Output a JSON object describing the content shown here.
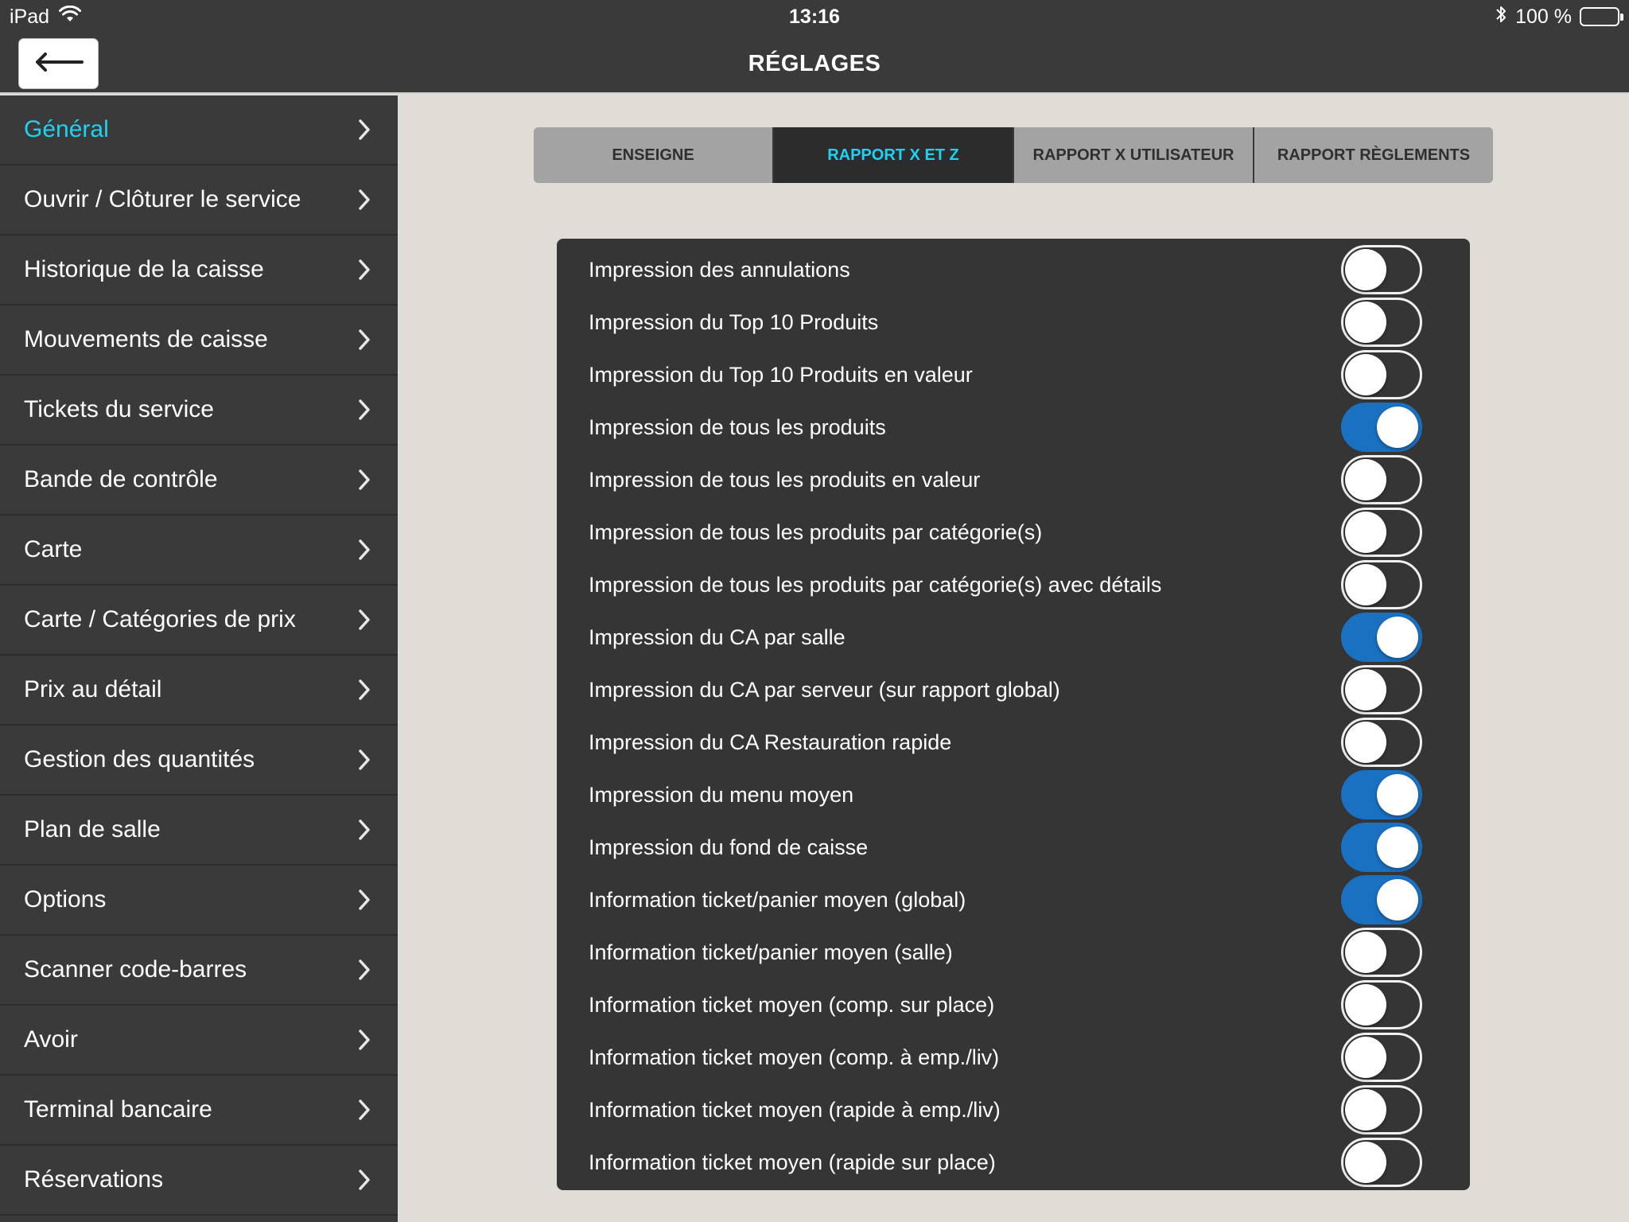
{
  "status_bar": {
    "device": "iPad",
    "time": "13:16",
    "battery_text": "100 %",
    "wifi_icon": "wifi-icon",
    "bluetooth_icon": "bluetooth-icon"
  },
  "header": {
    "title": "RÉGLAGES",
    "back_icon": "arrow-left-icon"
  },
  "colors": {
    "accent_cyan": "#1fd2f2",
    "toggle_on": "#1a70c1",
    "dark_bg": "#3a3a3a",
    "content_bg": "#e0dcd6"
  },
  "sidebar": {
    "items": [
      {
        "label": "Général",
        "active": true
      },
      {
        "label": "Ouvrir / Clôturer le service",
        "active": false
      },
      {
        "label": "Historique de la caisse",
        "active": false
      },
      {
        "label": "Mouvements de caisse",
        "active": false
      },
      {
        "label": "Tickets du service",
        "active": false
      },
      {
        "label": "Bande de contrôle",
        "active": false
      },
      {
        "label": "Carte",
        "active": false
      },
      {
        "label": "Carte / Catégories de prix",
        "active": false
      },
      {
        "label": "Prix au détail",
        "active": false
      },
      {
        "label": "Gestion des quantités",
        "active": false
      },
      {
        "label": "Plan de salle",
        "active": false
      },
      {
        "label": "Options",
        "active": false
      },
      {
        "label": "Scanner code-barres",
        "active": false
      },
      {
        "label": "Avoir",
        "active": false
      },
      {
        "label": "Terminal bancaire",
        "active": false
      },
      {
        "label": "Réservations",
        "active": false
      }
    ]
  },
  "tabs": [
    {
      "label": "ENSEIGNE",
      "active": false
    },
    {
      "label": "RAPPORT X ET Z",
      "active": true
    },
    {
      "label": "RAPPORT X UTILISATEUR",
      "active": false
    },
    {
      "label": "RAPPORT RÈGLEMENTS",
      "active": false
    }
  ],
  "settings": [
    {
      "label": "Impression des annulations",
      "on": false
    },
    {
      "label": "Impression du Top 10 Produits",
      "on": false
    },
    {
      "label": "Impression du Top 10 Produits en valeur",
      "on": false
    },
    {
      "label": "Impression de tous les produits",
      "on": true
    },
    {
      "label": "Impression de tous les produits en valeur",
      "on": false
    },
    {
      "label": "Impression de tous les produits par catégorie(s)",
      "on": false
    },
    {
      "label": "Impression de tous les produits par catégorie(s) avec détails",
      "on": false
    },
    {
      "label": "Impression du CA par salle",
      "on": true
    },
    {
      "label": "Impression du CA par serveur (sur rapport global)",
      "on": false
    },
    {
      "label": "Impression du CA Restauration rapide",
      "on": false
    },
    {
      "label": "Impression du menu moyen",
      "on": true
    },
    {
      "label": "Impression du fond de caisse",
      "on": true
    },
    {
      "label": "Information ticket/panier moyen (global)",
      "on": true
    },
    {
      "label": "Information ticket/panier moyen (salle)",
      "on": false
    },
    {
      "label": "Information ticket moyen (comp. sur place)",
      "on": false
    },
    {
      "label": "Information ticket moyen (comp. à emp./liv)",
      "on": false
    },
    {
      "label": "Information ticket moyen (rapide à emp./liv)",
      "on": false
    },
    {
      "label": "Information ticket moyen (rapide sur place)",
      "on": false
    }
  ]
}
